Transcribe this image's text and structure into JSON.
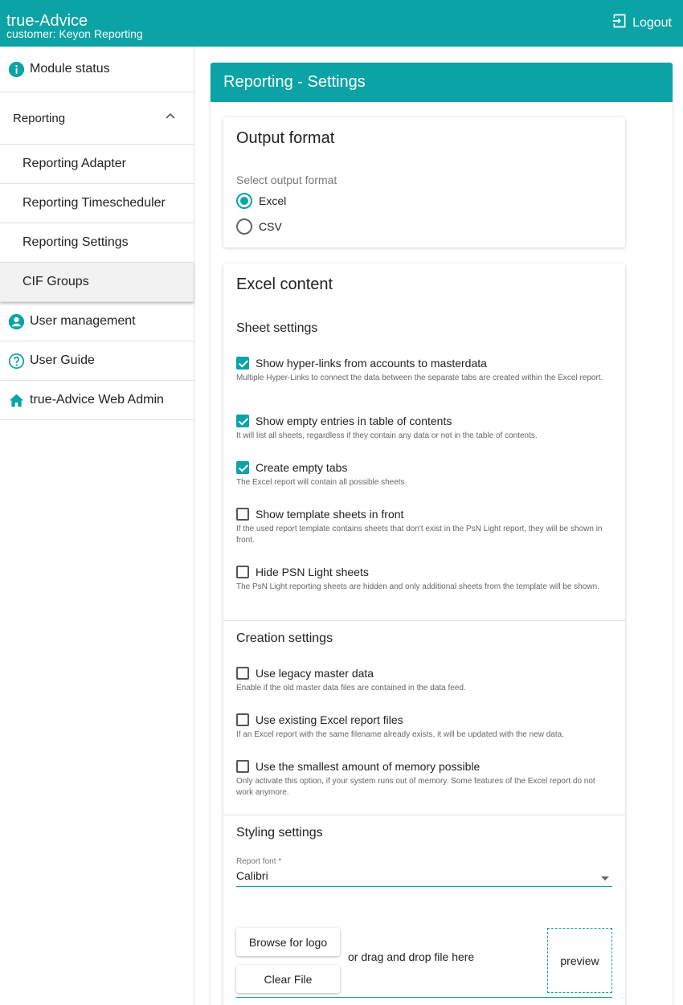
{
  "header": {
    "title": "true-Advice",
    "subtitle": "customer: Keyon Reporting",
    "logout_label": "Logout"
  },
  "sidebar": {
    "items": [
      {
        "label": "Module status",
        "icon": "info-icon"
      },
      {
        "label": "Reporting",
        "icon": "chevron-up-icon"
      },
      {
        "label": "Reporting Adapter"
      },
      {
        "label": "Reporting Timescheduler"
      },
      {
        "label": "Reporting Settings"
      },
      {
        "label": "CIF Groups"
      },
      {
        "label": "User management",
        "icon": "account-circle-icon"
      },
      {
        "label": "User Guide",
        "icon": "help-circle-icon"
      },
      {
        "label": "true-Advice Web Admin",
        "icon": "home-icon"
      }
    ]
  },
  "main": {
    "title": "Reporting - Settings",
    "output_format": {
      "title": "Output format",
      "select_label": "Select output format",
      "options": [
        {
          "label": "Excel",
          "selected": true
        },
        {
          "label": "CSV",
          "selected": false
        }
      ]
    },
    "excel_content": {
      "title": "Excel content",
      "sheet_settings": {
        "title": "Sheet settings",
        "items": [
          {
            "label": "Show hyper-links from accounts to masterdata",
            "checked": true,
            "desc": "Multiple Hyper-Links to connect the data between the separate tabs are created within the Excel report."
          },
          {
            "label": "Show empty entries in table of contents",
            "checked": true,
            "desc": "It will list all sheets, regardless if they contain any data or not in the table of contents."
          },
          {
            "label": "Create empty tabs",
            "checked": true,
            "desc": "The Excel report will contain all possible sheets."
          },
          {
            "label": "Show template sheets in front",
            "checked": false,
            "desc": "If the used report template contains sheets that don't exist in the PsN Light report, they will be shown in front."
          },
          {
            "label": "Hide PSN Light sheets",
            "checked": false,
            "desc": "The PsN Light reporting sheets are hidden and only additional sheets from the template will be shown."
          }
        ]
      },
      "creation_settings": {
        "title": "Creation settings",
        "items": [
          {
            "label": "Use legacy master data",
            "checked": false,
            "desc": "Enable if the old master data files are contained in the data feed."
          },
          {
            "label": "Use existing Excel report files",
            "checked": false,
            "desc": "If an Excel report with the same filename already exists, it will be updated with the new data."
          },
          {
            "label": "Use the smallest amount of memory possible",
            "checked": false,
            "desc": "Only activate this option, if your system runs out of memory. Some features of the Excel report do not work anymore."
          }
        ]
      },
      "styling_settings": {
        "title": "Styling settings",
        "font_label": "Report font *",
        "font_value": "Calibri",
        "browse_label": "Browse for logo",
        "clear_label": "Clear File",
        "drop_text": "or drag and drop file here",
        "preview_label": "preview"
      }
    }
  },
  "colors": {
    "accent": "#0ba3a5"
  }
}
